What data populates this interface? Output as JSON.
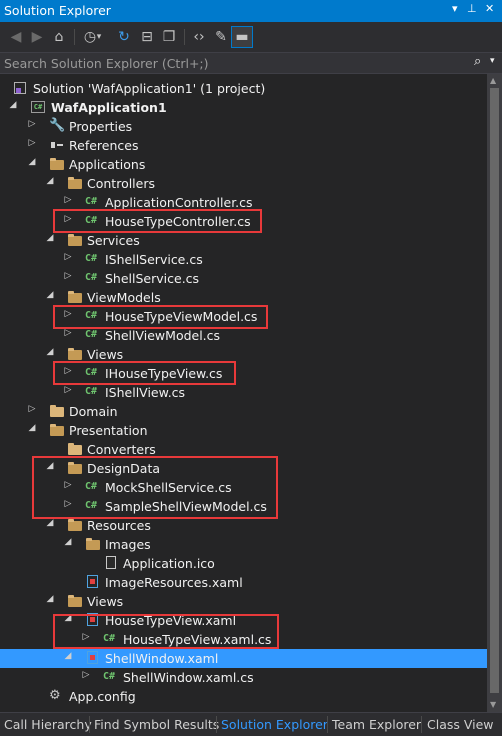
{
  "window": {
    "title": "Solution Explorer",
    "menu_glyph": "▾",
    "pin_glyph": "⊥",
    "close_glyph": "✕"
  },
  "toolbar": {
    "back_glyph": "◀",
    "forward_glyph": "▶",
    "home_glyph": "⌂",
    "history_glyph": "◷",
    "history_dropdown": "▾",
    "refresh_glyph": "↻",
    "collapse_glyph": "⊟",
    "show_files_glyph": "❐",
    "code_glyph": "‹›",
    "properties_glyph": "✎",
    "preview_glyph": "▬"
  },
  "search": {
    "placeholder": "Search Solution Explorer (Ctrl+;)",
    "value": "",
    "icon_glyph": "⌕",
    "dropdown_glyph": "▾"
  },
  "tree": [
    {
      "text": "Solution 'WafApplication1' (1 project)",
      "arrow": "",
      "icon": "solution-icon"
    },
    {
      "text": "WafApplication1",
      "arrow": "◢",
      "icon": "csharp-project-icon",
      "bold": true
    },
    {
      "text": "Properties",
      "arrow": "▷",
      "icon": "wrench-icon"
    },
    {
      "text": "References",
      "arrow": "▷",
      "icon": "references-icon"
    },
    {
      "text": "Applications",
      "arrow": "◢",
      "icon": "folder-open-icon"
    },
    {
      "text": "Controllers",
      "arrow": "◢",
      "icon": "folder-open-icon"
    },
    {
      "text": "ApplicationController.cs",
      "arrow": "▷",
      "icon": "csharp-file-icon"
    },
    {
      "text": "HouseTypeController.cs",
      "arrow": "▷",
      "icon": "csharp-file-icon"
    },
    {
      "text": "Services",
      "arrow": "◢",
      "icon": "folder-open-icon"
    },
    {
      "text": "IShellService.cs",
      "arrow": "▷",
      "icon": "csharp-file-icon"
    },
    {
      "text": "ShellService.cs",
      "arrow": "▷",
      "icon": "csharp-file-icon"
    },
    {
      "text": "ViewModels",
      "arrow": "◢",
      "icon": "folder-open-icon"
    },
    {
      "text": "HouseTypeViewModel.cs",
      "arrow": "▷",
      "icon": "csharp-file-icon"
    },
    {
      "text": "ShellViewModel.cs",
      "arrow": "▷",
      "icon": "csharp-file-icon"
    },
    {
      "text": "Views",
      "arrow": "◢",
      "icon": "folder-open-icon"
    },
    {
      "text": "IHouseTypeView.cs",
      "arrow": "▷",
      "icon": "csharp-file-icon"
    },
    {
      "text": "IShellView.cs",
      "arrow": "▷",
      "icon": "csharp-file-icon"
    },
    {
      "text": "Domain",
      "arrow": "▷",
      "icon": "folder-icon"
    },
    {
      "text": "Presentation",
      "arrow": "◢",
      "icon": "folder-open-icon"
    },
    {
      "text": "Converters",
      "arrow": "",
      "icon": "folder-icon"
    },
    {
      "text": "DesignData",
      "arrow": "◢",
      "icon": "folder-open-icon"
    },
    {
      "text": "MockShellService.cs",
      "arrow": "▷",
      "icon": "csharp-file-icon"
    },
    {
      "text": "SampleShellViewModel.cs",
      "arrow": "▷",
      "icon": "csharp-file-icon"
    },
    {
      "text": "Resources",
      "arrow": "◢",
      "icon": "folder-open-icon"
    },
    {
      "text": "Images",
      "arrow": "◢",
      "icon": "folder-open-icon"
    },
    {
      "text": "Application.ico",
      "arrow": "",
      "icon": "file-icon"
    },
    {
      "text": "ImageResources.xaml",
      "arrow": "",
      "icon": "xaml-file-icon"
    },
    {
      "text": "Views",
      "arrow": "◢",
      "icon": "folder-open-icon"
    },
    {
      "text": "HouseTypeView.xaml",
      "arrow": "◢",
      "icon": "xaml-file-icon"
    },
    {
      "text": "HouseTypeView.xaml.cs",
      "arrow": "▷",
      "icon": "csharp-file-icon"
    },
    {
      "text": "ShellWindow.xaml",
      "arrow": "◢",
      "icon": "xaml-file-icon",
      "selected": true
    },
    {
      "text": "ShellWindow.xaml.cs",
      "arrow": "▷",
      "icon": "csharp-file-icon"
    },
    {
      "text": "App.config",
      "arrow": "",
      "icon": "config-file-icon"
    }
  ],
  "highlight_color": "#e8393a",
  "selection_color": "#3399ff",
  "accent_color": "#007acc",
  "tabs": [
    {
      "label": "Call Hierarchy",
      "active": false
    },
    {
      "label": "Find Symbol Results",
      "active": false
    },
    {
      "label": "Solution Explorer",
      "active": true
    },
    {
      "label": "Team Explorer",
      "active": false
    },
    {
      "label": "Class View",
      "active": false
    }
  ]
}
